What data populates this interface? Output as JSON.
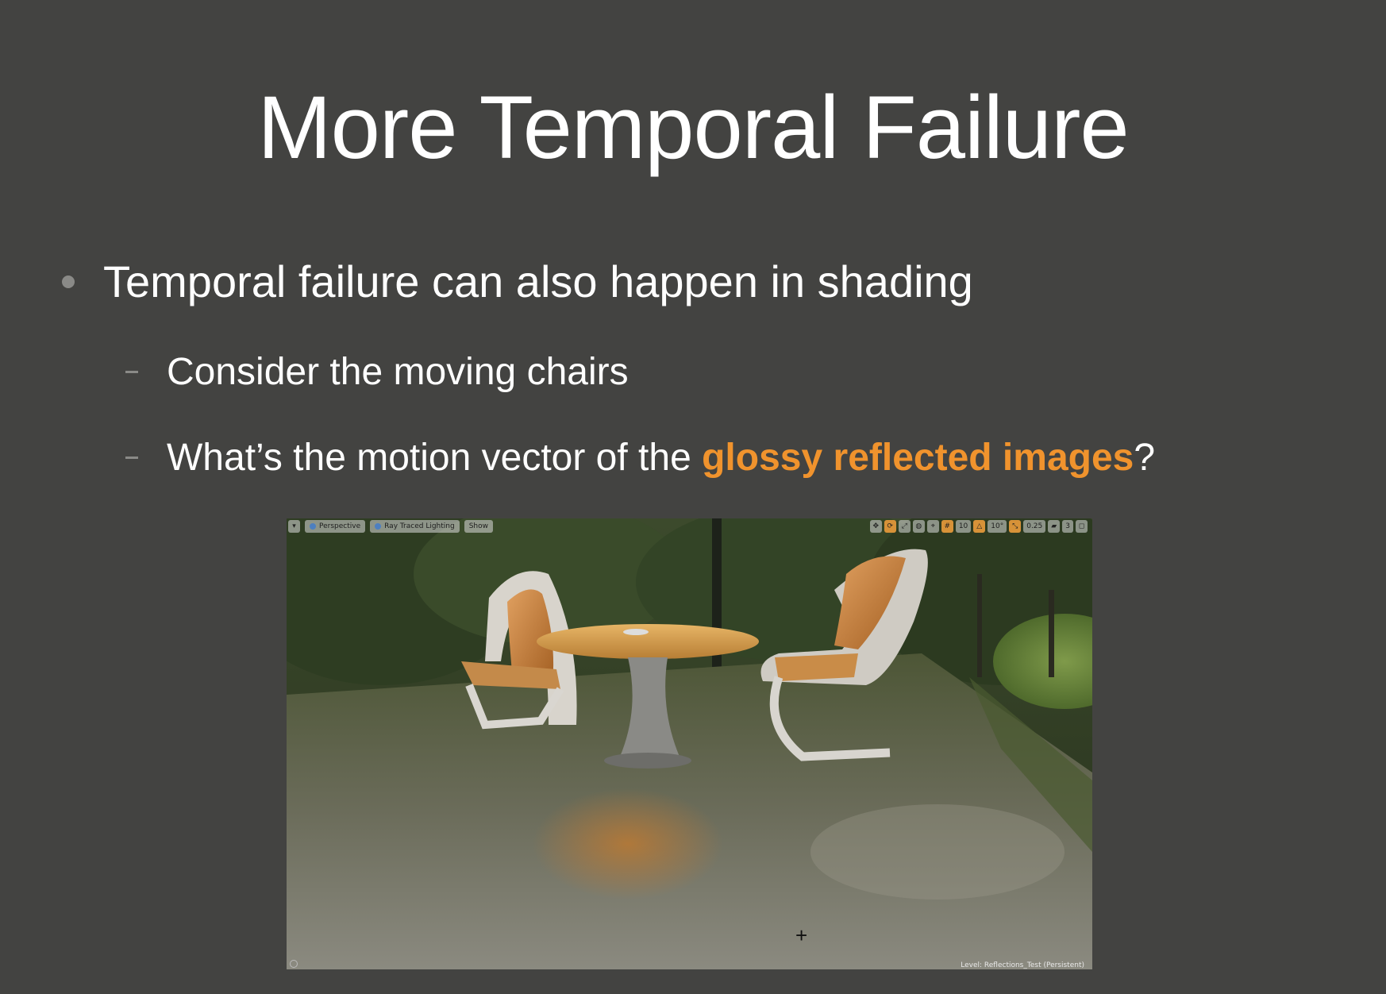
{
  "slide": {
    "title": "More Temporal Failure",
    "bullets": [
      {
        "text": "Temporal failure can also happen in shading"
      },
      {
        "text": "Consider the moving chairs"
      },
      {
        "prefix": "What’s the motion vector of the ",
        "highlight": "glossy reflected images",
        "suffix": "?"
      }
    ],
    "accent_color": "#f0932d",
    "background_color": "#434341"
  },
  "viewport": {
    "menu_icon": "dropdown-arrow-icon",
    "toolbar_left": [
      "Perspective",
      "Ray Traced Lighting",
      "Show"
    ],
    "toolbar_right": {
      "grid_snap": "10",
      "rotation_snap": "10°",
      "scale_snap": "0.25",
      "camera_speed": "3"
    },
    "level_label": "Level:  Reflections_Test (Persistent)",
    "crosshair": "+"
  }
}
